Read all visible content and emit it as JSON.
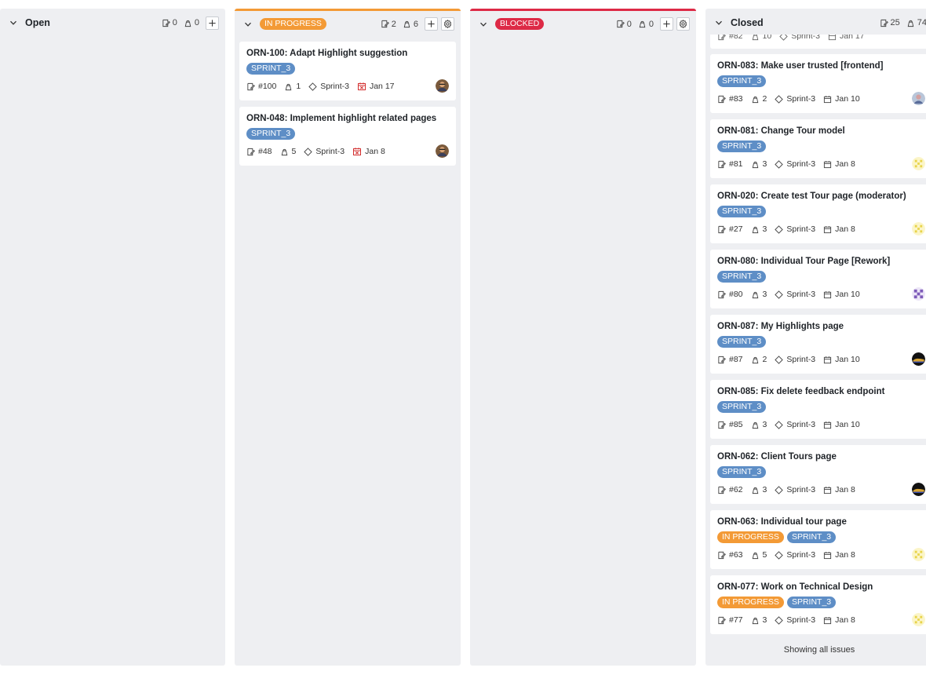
{
  "columns": {
    "open": {
      "title": "Open",
      "issues": "0",
      "points": "0"
    },
    "in_progress": {
      "title": "IN PROGRESS",
      "issues": "2",
      "points": "6",
      "cards": [
        {
          "title": "ORN-100: Adapt Highlight suggestion",
          "tag": "SPRINT_3",
          "number": "#100",
          "points": "1",
          "sprint": "Sprint-3",
          "date": "Jan 17"
        },
        {
          "title": "ORN-048: Implement highlight related pages",
          "tag": "SPRINT_3",
          "number": "#48",
          "points": "5",
          "sprint": "Sprint-3",
          "date": "Jan 8"
        }
      ]
    },
    "blocked": {
      "title": "BLOCKED",
      "issues": "0",
      "points": "0"
    },
    "closed": {
      "title": "Closed",
      "issues": "25",
      "points": "74",
      "clipped": {
        "number": "#82",
        "points": "10",
        "sprint": "Sprint-3",
        "date": "Jan 17"
      },
      "cards": [
        {
          "title": "ORN-083: Make user trusted [frontend]",
          "tag": "SPRINT_3",
          "number": "#83",
          "points": "2",
          "sprint": "Sprint-3",
          "date": "Jan 10",
          "avatar": "avatar-photo-icon"
        },
        {
          "title": "ORN-081: Change Tour model",
          "tag": "SPRINT_3",
          "number": "#81",
          "points": "3",
          "sprint": "Sprint-3",
          "date": "Jan 8",
          "avatar": "identicon-yellow-icon"
        },
        {
          "title": "ORN-020: Create test Tour page (moderator)",
          "tag": "SPRINT_3",
          "number": "#27",
          "points": "3",
          "sprint": "Sprint-3",
          "date": "Jan 8",
          "avatar": "identicon-yellow-icon"
        },
        {
          "title": "ORN-080: Individual Tour Page [Rework]",
          "tag": "SPRINT_3",
          "number": "#80",
          "points": "3",
          "sprint": "Sprint-3",
          "date": "Jan 10",
          "avatar": "identicon-purple-icon"
        },
        {
          "title": "ORN-087: My Highlights page",
          "tag": "SPRINT_3",
          "number": "#87",
          "points": "2",
          "sprint": "Sprint-3",
          "date": "Jan 10",
          "avatar": "avatar-dark-icon"
        },
        {
          "title": "ORN-085: Fix delete feedback endpoint",
          "tag": "SPRINT_3",
          "number": "#85",
          "points": "3",
          "sprint": "Sprint-3",
          "date": "Jan 10",
          "avatar": ""
        },
        {
          "title": "ORN-062: Client Tours page",
          "tag": "SPRINT_3",
          "number": "#62",
          "points": "3",
          "sprint": "Sprint-3",
          "date": "Jan 8",
          "avatar": "avatar-dark-icon"
        },
        {
          "title": "ORN-063: Individual tour page",
          "tag2": "IN PROGRESS",
          "tag": "SPRINT_3",
          "number": "#63",
          "points": "5",
          "sprint": "Sprint-3",
          "date": "Jan 8",
          "avatar": "identicon-yellow-icon"
        },
        {
          "title": "ORN-077: Work on Technical Design",
          "tag2": "IN PROGRESS",
          "tag": "SPRINT_3",
          "number": "#77",
          "points": "3",
          "sprint": "Sprint-3",
          "date": "Jan 8",
          "avatar": "identicon-yellow-icon"
        }
      ],
      "footer": "Showing all issues"
    }
  },
  "colors": {
    "in_progress": "#f39a36",
    "blocked": "#dd2a46",
    "sprint_tag": "#5e8ec6",
    "overdue": "#d32f2f"
  }
}
